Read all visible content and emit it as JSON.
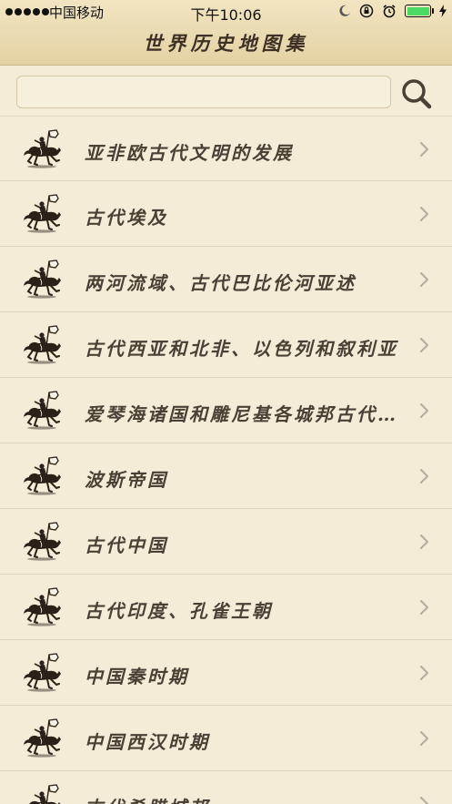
{
  "status_bar": {
    "carrier": "中国移动",
    "time": "下午10:06"
  },
  "header": {
    "title": "世界历史地图集"
  },
  "search": {
    "value": "",
    "placeholder": ""
  },
  "colors": {
    "background": "#f4ecd7",
    "header": "#e4d2a3",
    "text": "#4a4035",
    "battery": "#4cd964"
  },
  "list": {
    "items": [
      {
        "label": "亚非欧古代文明的发展"
      },
      {
        "label": "古代埃及"
      },
      {
        "label": "两河流域、古代巴比伦河亚述"
      },
      {
        "label": "古代西亚和北非、以色列和叙利亚"
      },
      {
        "label": "爱琴海诸国和雕尼基各城邦古代…"
      },
      {
        "label": "波斯帝国"
      },
      {
        "label": "古代中国"
      },
      {
        "label": "古代印度、孔雀王朝"
      },
      {
        "label": "中国秦时期"
      },
      {
        "label": "中国西汉时期"
      },
      {
        "label": "古代希腊城邦"
      }
    ]
  }
}
